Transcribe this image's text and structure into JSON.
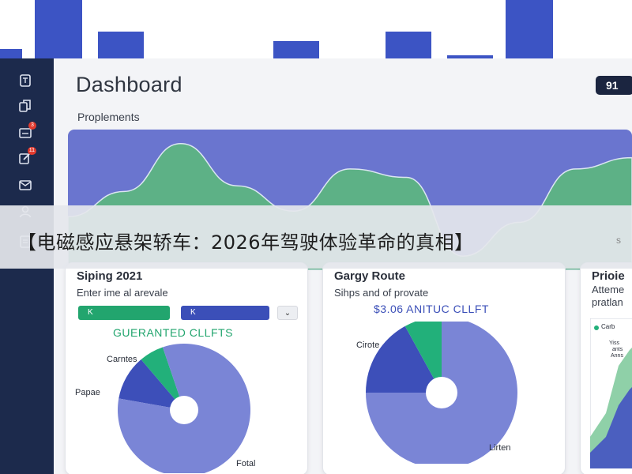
{
  "dashboard": {
    "title": "Dashboard",
    "badge": "91",
    "subheading": "Proplements"
  },
  "banner": {
    "text": "【电磁感应悬架轿车：2026年驾驶体验革命的真相】",
    "right_fragment": "s"
  },
  "sidebar": {
    "items": [
      {
        "icon": "document-icon",
        "badge": ""
      },
      {
        "icon": "copy-icon",
        "badge": ""
      },
      {
        "icon": "inbox-icon",
        "badge": "3"
      },
      {
        "icon": "edit-icon",
        "badge": "11"
      },
      {
        "icon": "mail-icon",
        "badge": ""
      },
      {
        "icon": "user-icon",
        "badge": ""
      },
      {
        "icon": "report-icon",
        "badge": ""
      }
    ]
  },
  "cards": [
    {
      "title": "Siping 2021",
      "subtitle": "Enter ime al arevale",
      "button_green": "K",
      "button_blue": "K",
      "dropdown": "⌄",
      "highlight": "GUERANTED CLLFTS",
      "pie_labels": [
        "Carntes",
        "Papae",
        "Fotal"
      ]
    },
    {
      "title": "Gargy Route",
      "subtitle": "Sihps and of provate",
      "highlight": "$3.06 ANITUC CLLFT",
      "pie_labels": [
        "Cirote",
        "Lirten"
      ]
    },
    {
      "title": "Prioie",
      "subtitle_lines": [
        "Atteme",
        "pratlan"
      ],
      "legend": "Carb",
      "mini_labels": [
        "Yiss",
        "ants",
        "Anns"
      ]
    }
  ],
  "colors": {
    "sidebar": "#1c2a4c",
    "accent_blue": "#3c54c4",
    "area_blue": "#6a75cf",
    "area_green": "#5db186",
    "pie_light": "#7a85d6",
    "pie_dark": "#3d4fb9",
    "pie_green": "#22b07a"
  },
  "chart_data": [
    {
      "type": "area",
      "title": "",
      "series": [
        {
          "values": [
            0.62,
            0.44,
            0.1,
            0.4,
            0.58,
            0.28,
            0.34,
            0.9,
            0.66,
            0.28,
            0.2
          ]
        }
      ]
    },
    {
      "type": "pie",
      "labels": [
        "Carntes",
        "Papae",
        "Fotal"
      ],
      "values": [
        11,
        6,
        83
      ],
      "donut": true
    },
    {
      "type": "pie",
      "labels": [
        "Cirote",
        "",
        "Lirten"
      ],
      "values": [
        17,
        8,
        75
      ],
      "donut": true
    }
  ]
}
